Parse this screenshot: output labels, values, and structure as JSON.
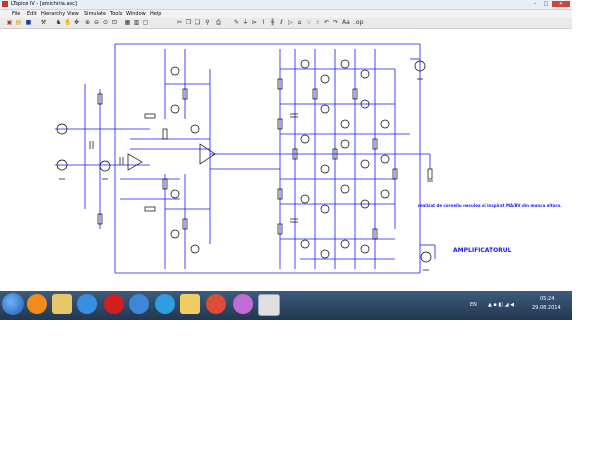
{
  "window": {
    "title": "LTspice IV - [amichiria.asc]"
  },
  "menu": [
    "File",
    "Edit",
    "Hierarchy",
    "View",
    "Simulate",
    "Tools",
    "Window",
    "Help"
  ],
  "annotations": {
    "note": "realizat de corneliu neculea si inspirat MA/BV din munca altora.",
    "heading": "AMPLIFICATORUL"
  },
  "tray": {
    "lang": "EN",
    "time": "05:24",
    "date": "29.08.2014"
  },
  "colors": {
    "wire": "#1a1aff",
    "component": "#000000",
    "taskbar": "#2b4363"
  },
  "icons": [
    "app-icon",
    "new-schematic-icon",
    "open-icon",
    "save-icon",
    "control-panel-icon",
    "run-icon",
    "halt-icon",
    "zoom-icons",
    "pan-icon",
    "cut-icon",
    "copy-icon",
    "paste-icon",
    "find-icon",
    "print-icon",
    "wire-icon",
    "ground-icon",
    "label-icon",
    "resistor-icon",
    "capacitor-icon",
    "inductor-icon",
    "diode-icon",
    "component-icon",
    "move-icon",
    "drag-icon",
    "undo-icon",
    "redo-icon",
    "text-icon",
    "spice-directive-icon"
  ]
}
